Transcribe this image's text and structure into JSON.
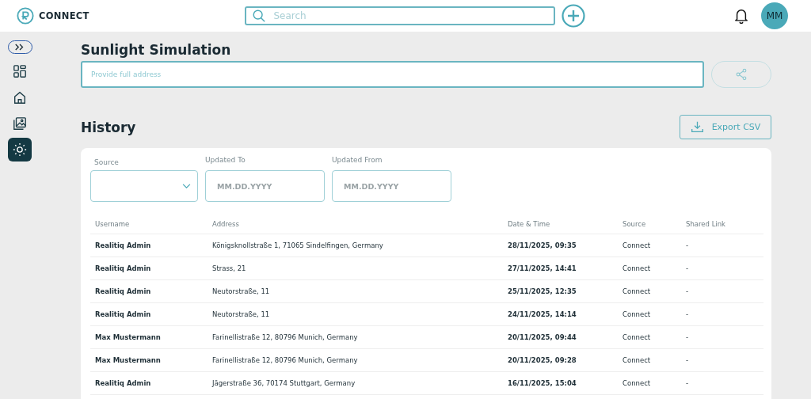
{
  "header": {
    "brand": "CONNECT",
    "search": {
      "placeholder": "Search"
    },
    "avatar": "MM"
  },
  "sidebar": {
    "items": [
      {
        "kind": "expand",
        "selected": false
      },
      {
        "kind": "grid",
        "selected": false
      },
      {
        "kind": "home",
        "selected": false
      },
      {
        "kind": "gallery",
        "selected": false
      },
      {
        "kind": "sun",
        "selected": true
      }
    ]
  },
  "page": {
    "title": "Sunlight Simulation",
    "address": {
      "placeholder": "Provide full address"
    }
  },
  "history": {
    "title": "History",
    "export": "Export CSV",
    "filters": [
      {
        "label": "Source",
        "kind": "select"
      },
      {
        "label": "Updated To",
        "kind": "date",
        "placeholder": "MM.DD.YYYY"
      },
      {
        "label": "Updated From",
        "kind": "date",
        "placeholder": "MM.DD.YYYY"
      }
    ],
    "columns": [
      "Username",
      "Address",
      "Date & Time",
      "Source",
      "Shared Link"
    ],
    "rows": [
      [
        "Realitiq Admin",
        "Königsknollstraße 1, 71065 Sindelfingen, Germany",
        "28/11/2025, 09:35",
        "Connect",
        "-"
      ],
      [
        "Realitiq Admin",
        "Strass, 21",
        "27/11/2025, 14:41",
        "Connect",
        "-"
      ],
      [
        "Realitiq Admin",
        "Neutorstraße, 11",
        "25/11/2025, 12:35",
        "Connect",
        "-"
      ],
      [
        "Realitiq Admin",
        "Neutorstraße, 11",
        "24/11/2025, 14:14",
        "Connect",
        "-"
      ],
      [
        "Max Mustermann",
        "Farinellistraße 12, 80796 Munich, Germany",
        "20/11/2025, 09:44",
        "Connect",
        "-"
      ],
      [
        "Max Mustermann",
        "Farinellistraße 12, 80796 Munich, Germany",
        "20/11/2025, 09:28",
        "Connect",
        "-"
      ],
      [
        "Realitiq Admin",
        "Jägerstraße 36, 70174 Stuttgart, Germany",
        "16/11/2025, 15:04",
        "Connect",
        "-"
      ]
    ]
  }
}
